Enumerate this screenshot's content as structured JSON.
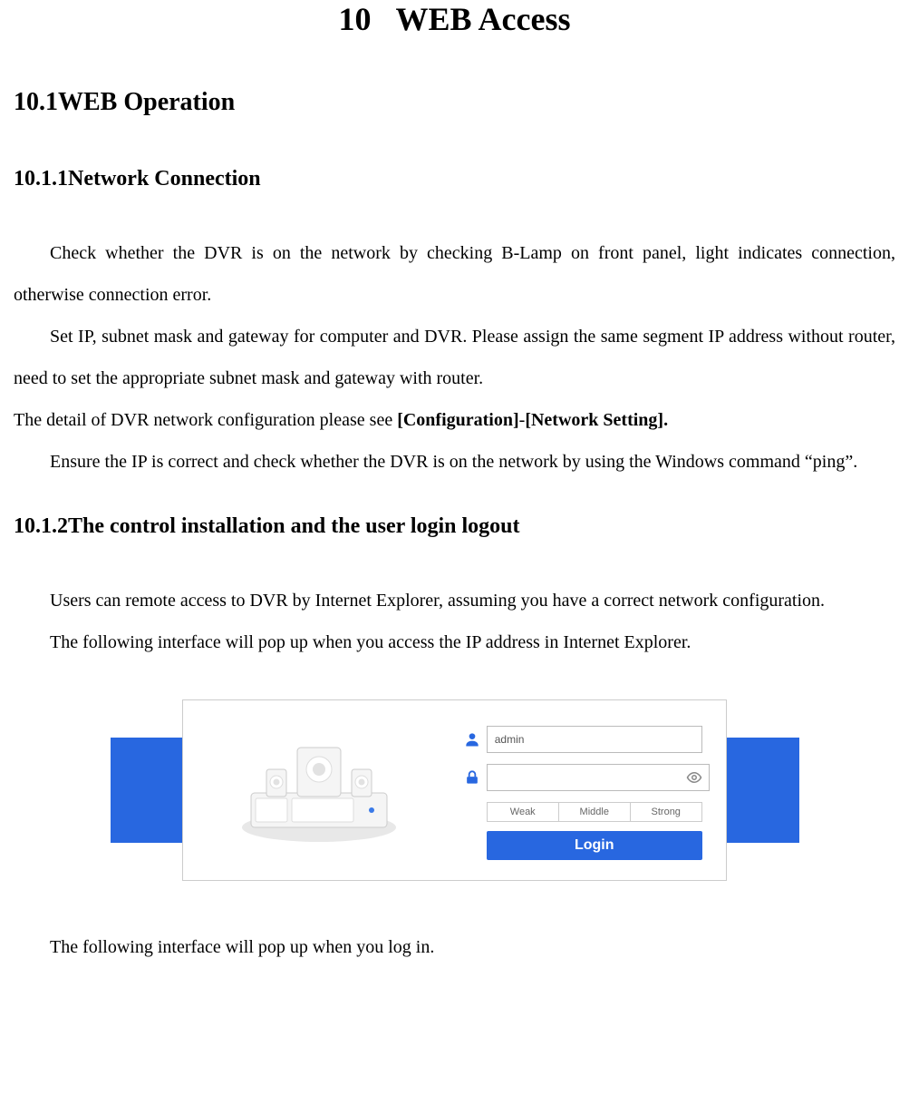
{
  "headings": {
    "chapter_number": "10",
    "chapter_title": "WEB Access",
    "h2_number": "10.1",
    "h2_title": "WEB Operation",
    "h3a_number": "10.1.1",
    "h3a_title": "Network Connection",
    "h3b_number": "10.1.2",
    "h3b_title": "The control installation and the user login logout"
  },
  "paragraphs": {
    "p1": "Check whether the DVR is on the network by checking B-Lamp on front panel, light indicates connection, otherwise connection error.",
    "p2": "Set IP, subnet mask and gateway for computer and DVR. Please assign the same segment IP address without router, need to set the appropriate subnet mask and gateway with router.",
    "p3a": "The detail of DVR network configuration please see ",
    "p3b": "[Configuration]",
    "p3c": "-",
    "p3d": "[Network Setting].",
    "p4": "Ensure the IP is correct and check whether the DVR is on the network by using the Windows command “ping”.",
    "p5": "Users can remote access to DVR by Internet Explorer, assuming you have a correct network configuration.",
    "p6": "The following interface will pop up when you access the IP address in Internet Explorer.",
    "p7": "The following interface will pop up when you log in."
  },
  "login": {
    "username_value": "admin",
    "password_value": "",
    "strength_weak": "Weak",
    "strength_middle": "Middle",
    "strength_strong": "Strong",
    "login_button": "Login"
  }
}
